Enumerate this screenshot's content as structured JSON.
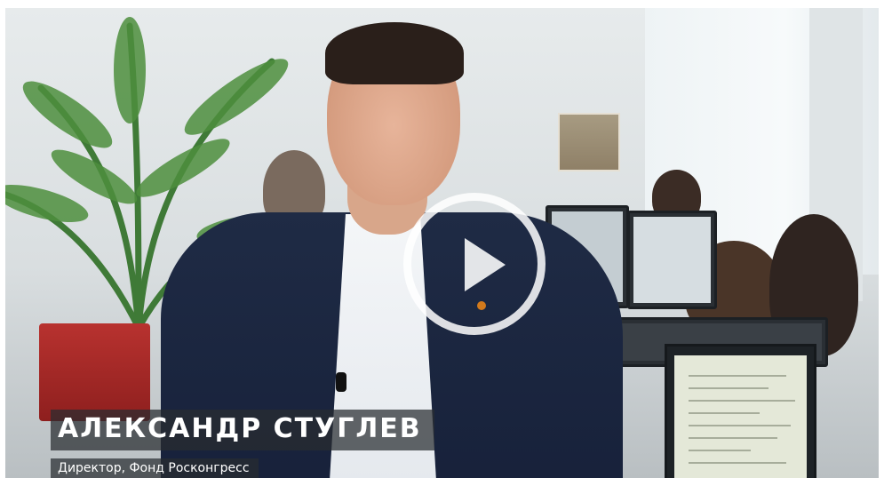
{
  "video": {
    "speaker_name": "АЛЕКСАНДР СТУГЛЕВ",
    "speaker_title": "Директор, Фонд Росконгресс",
    "play_icon": "play-icon"
  },
  "colors": {
    "caption_bg": "#282c30",
    "caption_text": "#ffffff",
    "play_ring": "#ffffff"
  }
}
